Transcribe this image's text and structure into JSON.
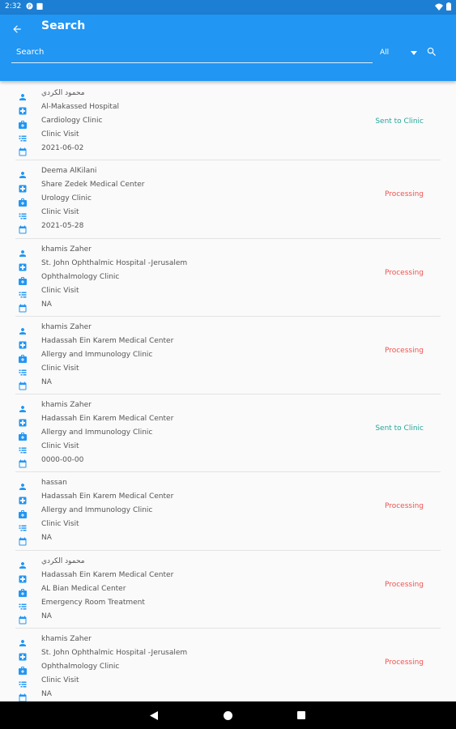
{
  "statusbar": {
    "time": "2:32"
  },
  "appbar": {
    "title": "Search",
    "search_placeholder": "Search",
    "filter_value": "All"
  },
  "colors": {
    "primary": "#2196f3",
    "status_sent": "#26a69a",
    "status_processing": "#ef5350",
    "icon": "#2196f3"
  },
  "records": [
    {
      "name": "محمود الكردي",
      "hospital": "Al-Makassed Hospital",
      "clinic": "Cardiology Clinic",
      "visit_type": "Clinic Visit",
      "date": "2021-06-02",
      "status": "Sent to Clinic",
      "status_kind": "sent"
    },
    {
      "name": "Deema AlKilani",
      "hospital": "Share Zedek Medical Center",
      "clinic": "Urology Clinic",
      "visit_type": "Clinic Visit",
      "date": "2021-05-28",
      "status": "Processing",
      "status_kind": "processing"
    },
    {
      "name": "khamis Zaher",
      "hospital": "St. John Ophthalmic Hospital -Jerusalem",
      "clinic": "Ophthalmology Clinic",
      "visit_type": "Clinic Visit",
      "date": "NA",
      "status": "Processing",
      "status_kind": "processing"
    },
    {
      "name": "khamis Zaher",
      "hospital": "Hadassah Ein Karem Medical Center",
      "clinic": "Allergy and Immunology Clinic",
      "visit_type": "Clinic Visit",
      "date": "NA",
      "status": "Processing",
      "status_kind": "processing"
    },
    {
      "name": "khamis Zaher",
      "hospital": "Hadassah Ein Karem Medical Center",
      "clinic": "Allergy and Immunology Clinic",
      "visit_type": "Clinic Visit",
      "date": "0000-00-00",
      "status": "Sent to Clinic",
      "status_kind": "sent"
    },
    {
      "name": "hassan",
      "hospital": "Hadassah Ein Karem Medical Center",
      "clinic": "Allergy and Immunology Clinic",
      "visit_type": "Clinic Visit",
      "date": "NA",
      "status": "Processing",
      "status_kind": "processing"
    },
    {
      "name": "محمود الكردي",
      "hospital": "Hadassah Ein Karem Medical Center",
      "clinic": "AL Bian Medical Center",
      "visit_type": "Emergency Room Treatment",
      "date": "NA",
      "status": "Processing",
      "status_kind": "processing"
    },
    {
      "name": "khamis Zaher",
      "hospital": "St. John Ophthalmic Hospital -Jerusalem",
      "clinic": "Ophthalmology Clinic",
      "visit_type": "Clinic Visit",
      "date": "NA",
      "status": "Processing",
      "status_kind": "processing"
    }
  ],
  "icons": {
    "name": "person-icon",
    "hospital": "hospital-icon",
    "clinic": "medical-bag-icon",
    "visit_type": "visit-type-icon",
    "date": "calendar-icon"
  }
}
